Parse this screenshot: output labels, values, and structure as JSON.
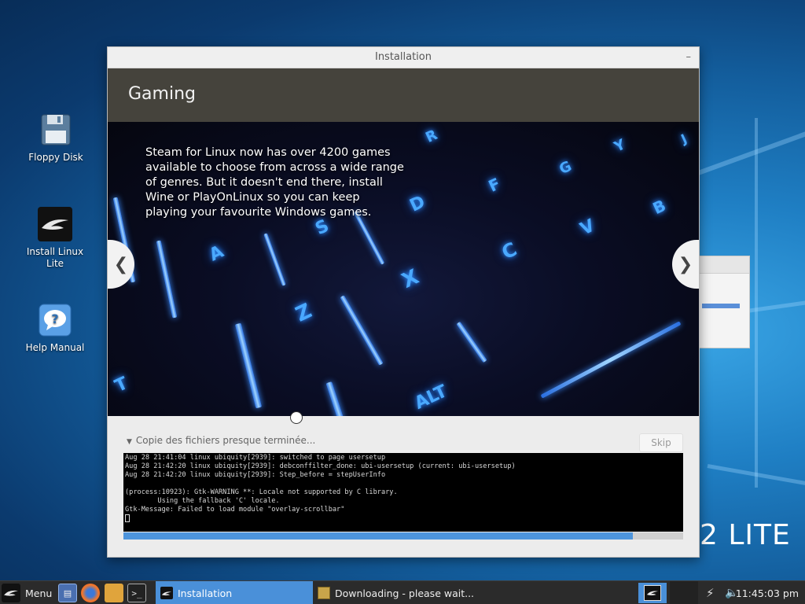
{
  "desktop": {
    "icons": [
      {
        "label": "Floppy Disk",
        "icon": "floppy-disk-icon"
      },
      {
        "label": "Install Linux Lite",
        "icon": "linux-lite-feather-icon"
      },
      {
        "label": "Help Manual",
        "icon": "help-question-icon"
      }
    ],
    "branding_text": "2 LITE"
  },
  "installer": {
    "title": "Installation",
    "minimize_symbol": "–",
    "header": "Gaming",
    "slide": {
      "text": "Steam for Linux now has over 4200 games available to choose from across a wide range of genres. But it doesn't end there, install Wine or PlayOnLinux so you can keep playing your favourite Windows games.",
      "prev_symbol": "❮",
      "next_symbol": "❯",
      "keys": [
        "R",
        "G",
        "F",
        "D",
        "S",
        "A",
        "X",
        "Z",
        "C",
        "V",
        "B",
        "ALT",
        "T",
        "Y",
        "J"
      ]
    },
    "status": "Copie des fichiers presque terminée...",
    "skip_label": "Skip",
    "terminal_lines": [
      "Aug 28 21:41:04 linux ubiquity[2939]: switched to page usersetup",
      "Aug 28 21:42:20 linux ubiquity[2939]: debconffilter_done: ubi-usersetup (current: ubi-usersetup)",
      "Aug 28 21:42:20 linux ubiquity[2939]: Step_before = stepUserInfo",
      "",
      "(process:10923): Gtk-WARNING **: Locale not supported by C library.",
      "        Using the fallback 'C' locale.",
      "Gtk-Message: Failed to load module \"overlay-scrollbar\""
    ],
    "progress_percent": 91,
    "colors": {
      "header_bg": "#45433c",
      "progress": "#4d94db"
    }
  },
  "taskbar": {
    "menu_label": "Menu",
    "launchers": [
      "file-manager-icon",
      "firefox-icon",
      "folder-icon",
      "terminal-icon"
    ],
    "tasks": [
      {
        "label": "Installation",
        "active": true,
        "icon": "linux-lite-feather-icon"
      },
      {
        "label": "Downloading - please wait...",
        "active": false,
        "icon": "package-icon"
      }
    ],
    "clock": "11:45:03 pm",
    "tray_icons": [
      "tray-app-icon",
      "network-icon",
      "volume-icon"
    ]
  }
}
